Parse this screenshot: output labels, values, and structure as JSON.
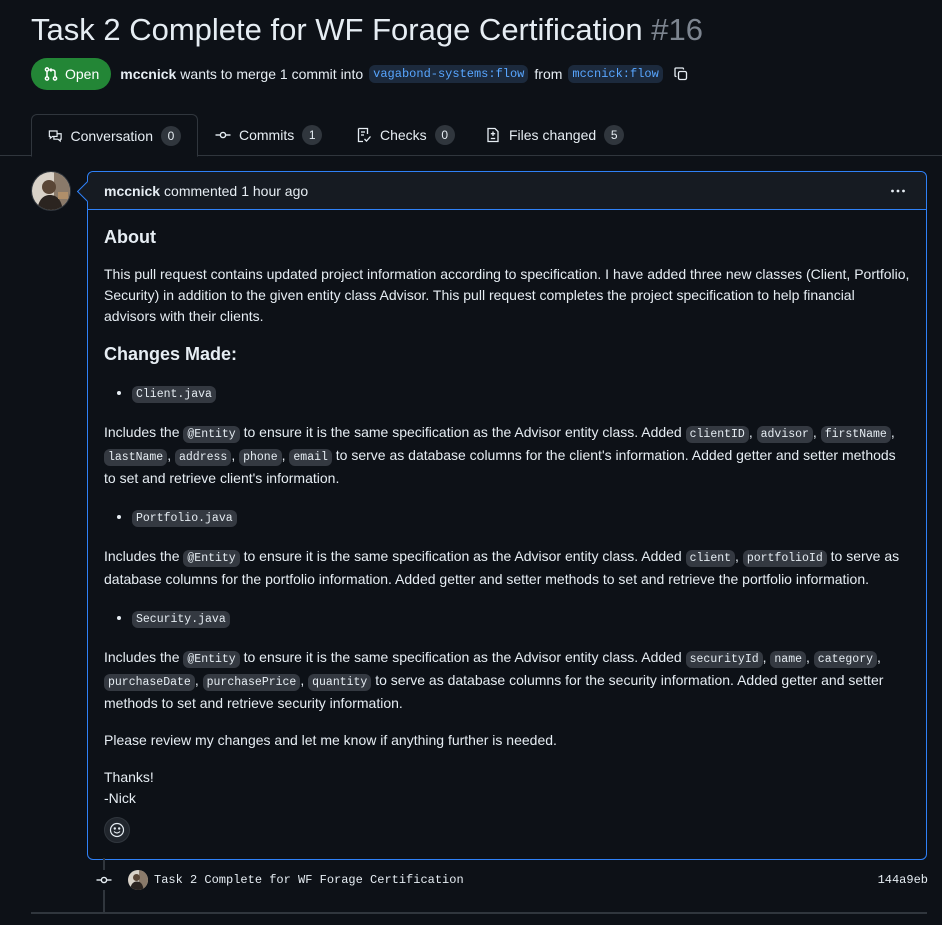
{
  "pr": {
    "title": "Task 2 Complete for WF Forage Certification",
    "number": "#16",
    "state": "Open",
    "author": "mccnick",
    "merge_text": "wants to merge 1 commit into",
    "base_branch": "vagabond-systems:flow",
    "from_text": "from",
    "head_branch": "mccnick:flow"
  },
  "tabs": [
    {
      "label": "Conversation",
      "count": "0",
      "icon": "comment-discussion-icon"
    },
    {
      "label": "Commits",
      "count": "1",
      "icon": "git-commit-icon"
    },
    {
      "label": "Checks",
      "count": "0",
      "icon": "checklist-icon"
    },
    {
      "label": "Files changed",
      "count": "5",
      "icon": "file-diff-icon"
    }
  ],
  "comment": {
    "author": "mccnick",
    "action": "commented",
    "time": "1 hour ago",
    "heading_about": "About",
    "about_text": "This pull request contains updated project information according to specification. I have added three new classes (Client, Portfolio, Security) in addition to the given entity class Advisor. This pull request completes the project specification to help financial advisors with their clients.",
    "heading_changes": "Changes Made:",
    "files": [
      {
        "name": "Client.java",
        "pre": "Includes the ",
        "entity": "@Entity",
        "mid": " to ensure it is the same specification as the Advisor entity class. Added ",
        "fields": [
          "clientID",
          "advisor",
          "firstName",
          "lastName",
          "address",
          "phone",
          "email"
        ],
        "post": " to serve as database columns for the client's information. Added getter and setter methods to set and retrieve client's information."
      },
      {
        "name": "Portfolio.java",
        "pre": "Includes the ",
        "entity": "@Entity",
        "mid": " to ensure it is the same specification as the Advisor entity class. Added ",
        "fields": [
          "client",
          "portfolioId"
        ],
        "post": " to serve as database columns for the portfolio information. Added getter and setter methods to set and retrieve the portfolio information."
      },
      {
        "name": "Security.java",
        "pre": "Includes the ",
        "entity": "@Entity",
        "mid": " to ensure it is the same specification as the Advisor entity class. Added ",
        "fields": [
          "securityId",
          "name",
          "category",
          "purchaseDate",
          "purchasePrice",
          "quantity"
        ],
        "post": " to serve as database columns for the security information. Added getter and setter methods to set and retrieve security information."
      }
    ],
    "closing": "Please review my changes and let me know if anything further is needed.",
    "signoff_1": "Thanks!",
    "signoff_2": "-Nick"
  },
  "commit": {
    "message": "Task 2 Complete for WF Forage Certification",
    "sha": "144a9eb"
  },
  "colors": {
    "background": "#0d1117",
    "open_badge": "#238636",
    "focus_border": "#2f81f7",
    "branch_text": "#58a6ff"
  }
}
